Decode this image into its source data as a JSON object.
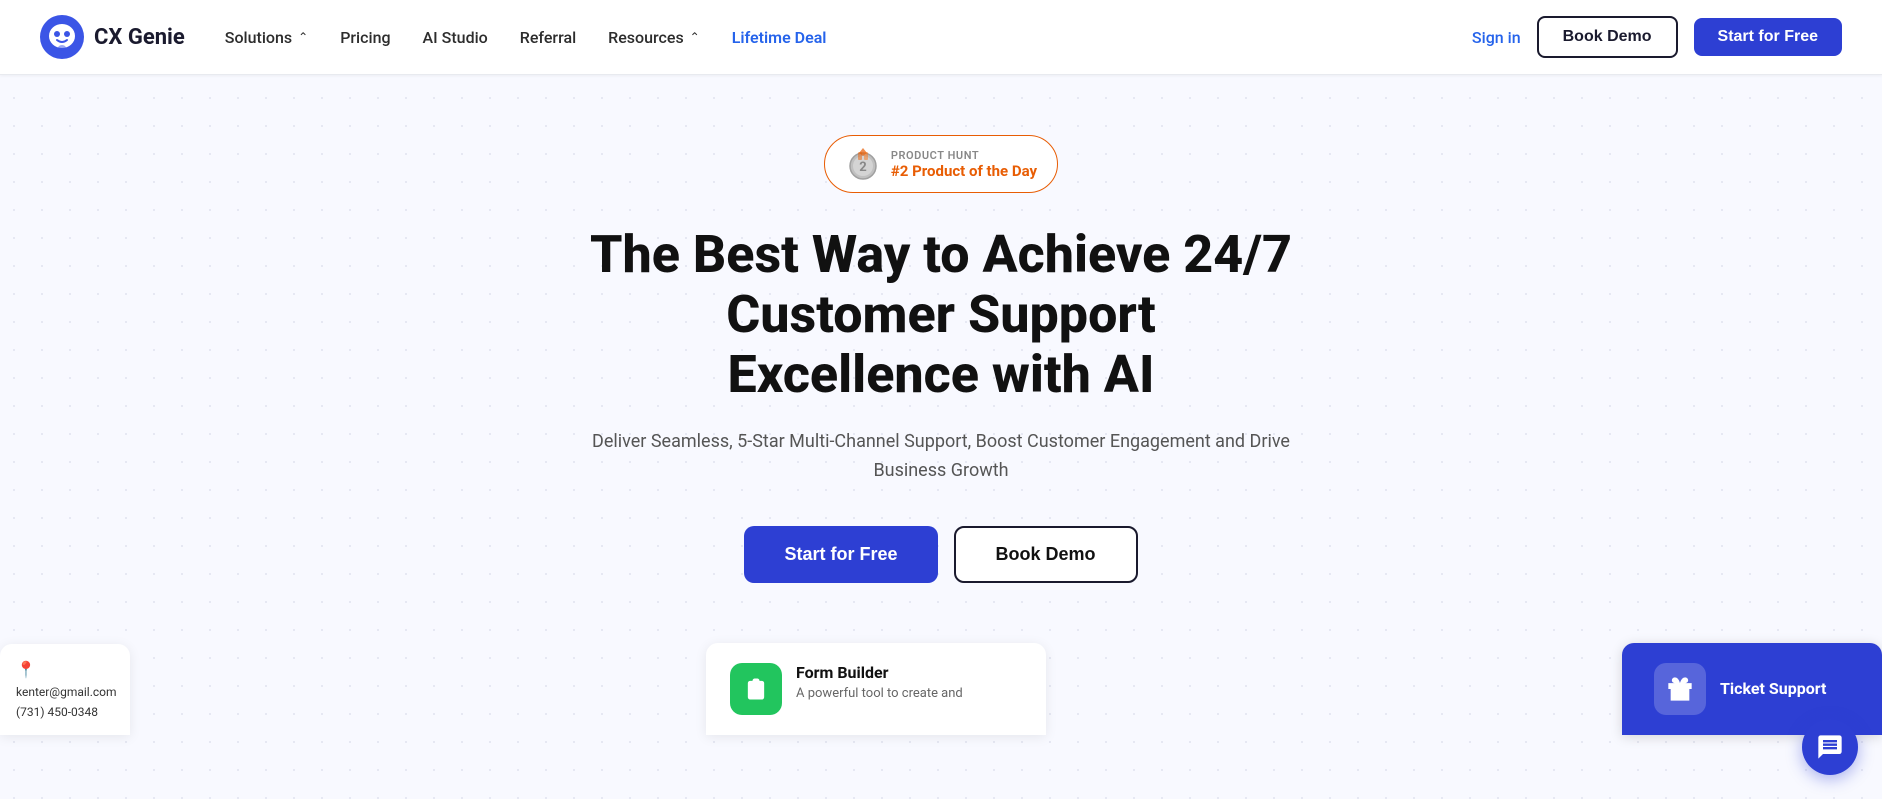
{
  "brand": {
    "name": "CX Genie",
    "logo_alt": "CX Genie logo"
  },
  "nav": {
    "links": [
      {
        "id": "solutions",
        "label": "Solutions",
        "has_dropdown": true
      },
      {
        "id": "pricing",
        "label": "Pricing",
        "has_dropdown": false
      },
      {
        "id": "ai-studio",
        "label": "AI Studio",
        "has_dropdown": false
      },
      {
        "id": "referral",
        "label": "Referral",
        "has_dropdown": false
      },
      {
        "id": "resources",
        "label": "Resources",
        "has_dropdown": true
      },
      {
        "id": "lifetime-deal",
        "label": "Lifetime Deal",
        "has_dropdown": false,
        "highlight": true
      }
    ],
    "sign_in": "Sign in",
    "book_demo": "Book Demo",
    "start_for_free": "Start for Free"
  },
  "hero": {
    "badge": {
      "label": "PRODUCT HUNT",
      "title": "#2 Product of the Day"
    },
    "heading_line1": "The Best Way to Achieve 24/7 Customer Support",
    "heading_line2": "Excellence with AI",
    "subtext": "Deliver Seamless, 5-Star Multi-Channel Support, Boost Customer Engagement and Drive Business Growth",
    "start_for_free": "Start for Free",
    "book_demo": "Book Demo"
  },
  "bottom": {
    "left_card": {
      "email": "kenter@gmail.com",
      "phone": "(731) 450-0348"
    },
    "center_card": {
      "title": "Form Builder",
      "description": "A powerful tool to create and"
    },
    "right_card": {
      "title": "Ticket Support"
    }
  },
  "chat_button": {
    "aria_label": "Chat Support"
  }
}
